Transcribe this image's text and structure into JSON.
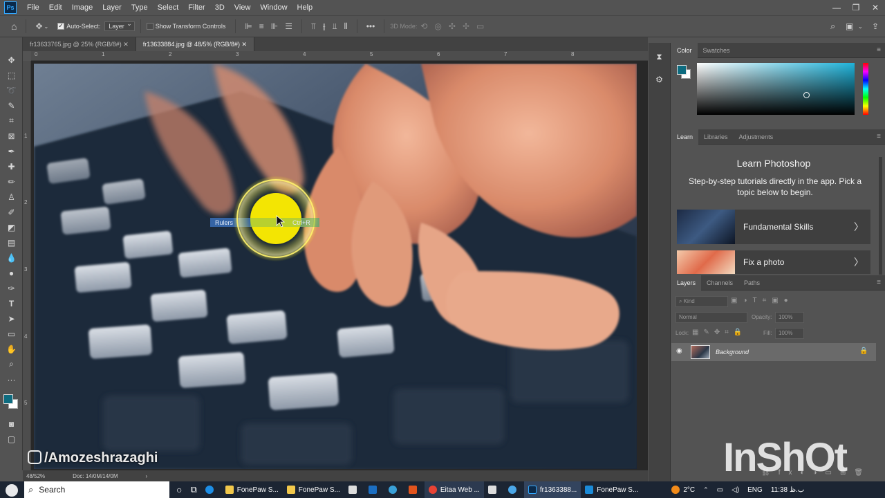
{
  "app": {
    "logo_text": "Ps",
    "menus": [
      "File",
      "Edit",
      "Image",
      "Layer",
      "Type",
      "Select",
      "Filter",
      "3D",
      "View",
      "Window",
      "Help"
    ],
    "window_controls": [
      "—",
      "❐",
      "✕"
    ]
  },
  "options_bar": {
    "auto_select_label": "Auto-Select:",
    "auto_select_checked": true,
    "auto_select_target": "Layer",
    "show_transform_label": "Show Transform Controls",
    "show_transform_checked": false,
    "mode_label": "3D Mode:"
  },
  "tabs": [
    {
      "label": "fr13633765.jpg @ 25% (RGB/8#)",
      "active": false
    },
    {
      "label": "fr13633884.jpg @ 48/5% (RGB/8#)",
      "active": true
    }
  ],
  "ruler_top_labels": [
    "0",
    "1",
    "2",
    "3",
    "4",
    "5",
    "6",
    "7",
    "8"
  ],
  "ruler_left_labels": [
    "1",
    "2",
    "3",
    "4",
    "5"
  ],
  "context_menu": {
    "item": "Rulers",
    "shortcut": "Ctrl+R"
  },
  "status": {
    "zoom": "48/52%",
    "doc": "Doc: 14/0M/14/0M"
  },
  "color_panel": {
    "tabs": [
      "Color",
      "Swatches"
    ],
    "foreground": "#0e6c80",
    "background": "#ffffff",
    "hue_color": "#1fb3da"
  },
  "learn_panel": {
    "tabs": [
      "Learn",
      "Libraries",
      "Adjustments"
    ],
    "title": "Learn Photoshop",
    "description": "Step-by-step tutorials directly in the app. Pick a topic below to begin.",
    "cards": [
      {
        "label": "Fundamental Skills"
      },
      {
        "label": "Fix a photo"
      }
    ]
  },
  "layers_panel": {
    "tabs": [
      "Layers",
      "Channels",
      "Paths"
    ],
    "filter_placeholder": "Kind",
    "blend_mode": "Normal",
    "opacity_label": "Opacity:",
    "opacity_value": "100%",
    "lock_label": "Lock:",
    "fill_label": "Fill:",
    "fill_value": "100%",
    "layers": [
      {
        "name": "Background",
        "visible": true,
        "locked": true
      }
    ]
  },
  "watermark": {
    "channel": "/Amozeshrazaghi",
    "brand": "InShOt"
  },
  "taskbar": {
    "search_placeholder": "Search",
    "apps": [
      "FonePaw S...",
      "FonePaw S...",
      "Eitaa Web ...",
      "fr1363388...",
      "FonePaw S..."
    ],
    "weather": "2°C",
    "language": "ENG",
    "clock": "11:38 ب.ظ"
  }
}
